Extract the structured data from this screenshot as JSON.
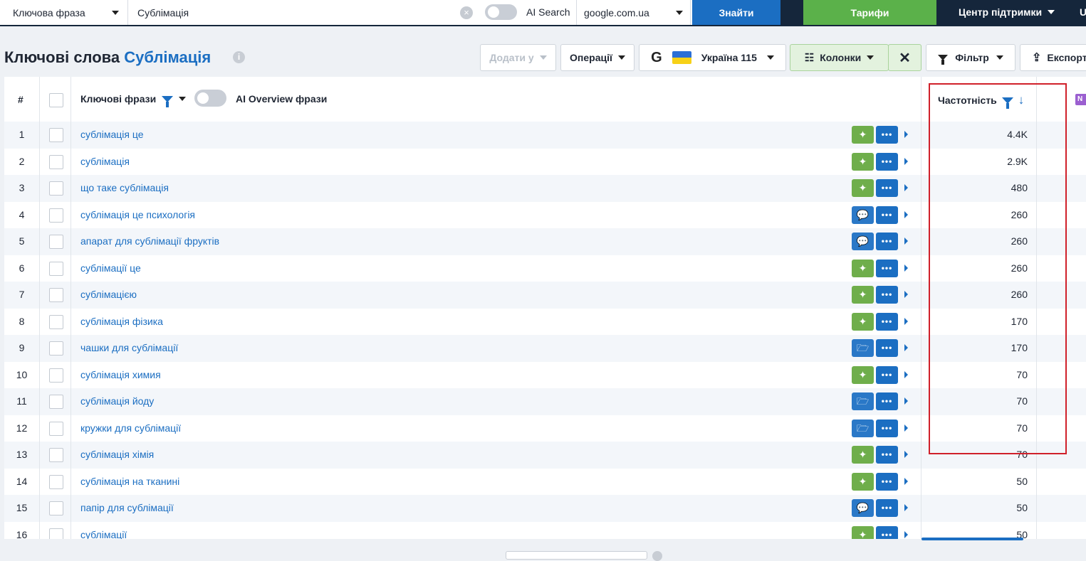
{
  "search": {
    "type_label": "Ключова фраза",
    "query": "Сублімація",
    "ai_search_label": "AI Search",
    "engine": "google.com.ua",
    "find_label": "Знайти"
  },
  "nav": {
    "tariffs_label": "Тарифи",
    "support_label": "Центр підтримки",
    "user_initial": "U"
  },
  "header": {
    "title_prefix": "Ключові слова",
    "title_keyword": "Сублімація",
    "info_icon": "i",
    "add_to_label": "Додати у",
    "operations_label": "Операції",
    "google_letter": "G",
    "country_label": "Україна 115",
    "columns_label": "Колонки",
    "columns_icon": "☷",
    "close_icon": "✕",
    "filter_label": "Фільтр",
    "export_label": "Експорт",
    "export_icon": "⇪"
  },
  "table": {
    "col_num": "#",
    "col_keywords": "Ключові фрази",
    "col_ai_overview": "AI Overview фрази",
    "col_frequency": "Частотність",
    "sort_arrow": "↓",
    "new_badge": "N",
    "more_glyph": "•••",
    "rows": [
      {
        "n": "1",
        "kw": "сублімація це",
        "intent": "sparkle",
        "freq": "4.4K"
      },
      {
        "n": "2",
        "kw": "сублімація",
        "intent": "sparkle",
        "freq": "2.9K"
      },
      {
        "n": "3",
        "kw": "що таке сублімація",
        "intent": "sparkle",
        "freq": "480"
      },
      {
        "n": "4",
        "kw": "сублімація це психологія",
        "intent": "chat",
        "freq": "260"
      },
      {
        "n": "5",
        "kw": "апарат для сублімації фруктів",
        "intent": "chat",
        "freq": "260"
      },
      {
        "n": "6",
        "kw": "сублімації це",
        "intent": "sparkle",
        "freq": "260"
      },
      {
        "n": "7",
        "kw": "сублімацією",
        "intent": "sparkle",
        "freq": "260"
      },
      {
        "n": "8",
        "kw": "сублімація фізика",
        "intent": "sparkle",
        "freq": "170"
      },
      {
        "n": "9",
        "kw": "чашки для сублімації",
        "intent": "shop",
        "freq": "170"
      },
      {
        "n": "10",
        "kw": "сублімація химия",
        "intent": "sparkle",
        "freq": "70"
      },
      {
        "n": "11",
        "kw": "сублімація йоду",
        "intent": "shop",
        "freq": "70"
      },
      {
        "n": "12",
        "kw": "кружки для сублімації",
        "intent": "shop",
        "freq": "70"
      },
      {
        "n": "13",
        "kw": "сублімація хімія",
        "intent": "sparkle",
        "freq": "70"
      },
      {
        "n": "14",
        "kw": "сублімація на тканині",
        "intent": "sparkle",
        "freq": "50"
      },
      {
        "n": "15",
        "kw": "папір для сублімації",
        "intent": "chat",
        "freq": "50"
      },
      {
        "n": "16",
        "kw": "сублімації",
        "intent": "sparkle",
        "freq": "50"
      }
    ]
  },
  "intent_glyphs": {
    "sparkle": "✦",
    "chat": "💬",
    "shop": "🗁"
  },
  "colors": {
    "accent": "#1b6ec2",
    "brand_green": "#5bb14a",
    "nav_dark": "#15263b",
    "highlight": "#d0202a"
  }
}
